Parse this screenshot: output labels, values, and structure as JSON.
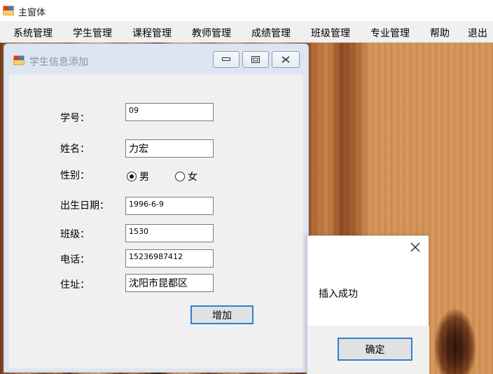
{
  "main_window": {
    "title": "主窗体"
  },
  "menu": {
    "items": [
      {
        "label": "系统管理"
      },
      {
        "label": "学生管理"
      },
      {
        "label": "课程管理"
      },
      {
        "label": "教师管理"
      },
      {
        "label": "成绩管理"
      },
      {
        "label": "班级管理"
      },
      {
        "label": "专业管理"
      },
      {
        "label": "帮助"
      },
      {
        "label": "退出"
      }
    ]
  },
  "child_window": {
    "title": "学生信息添加",
    "controls": [
      "minimize-icon",
      "restore-icon",
      "close-icon"
    ]
  },
  "form": {
    "student_id": {
      "label": "学号：",
      "value": "09"
    },
    "name": {
      "label": "姓名：",
      "value": "力宏"
    },
    "gender": {
      "label": "性别：",
      "options": [
        "男",
        "女"
      ],
      "selected": "男"
    },
    "birth_date": {
      "label": "出生日期：",
      "value": "1996-6-9"
    },
    "class": {
      "label": "班级：",
      "value": "1530"
    },
    "phone": {
      "label": "电话：",
      "value": "15236987412"
    },
    "address": {
      "label": "住址：",
      "value": "沈阳市昆都区"
    },
    "add_button": "增加"
  },
  "message_box": {
    "text": "插入成功",
    "ok_button": "确定"
  },
  "colors": {
    "focus_border": "#2f7fd1",
    "window_bg": "#f0f0f0",
    "child_frame": "#dce6f2"
  }
}
